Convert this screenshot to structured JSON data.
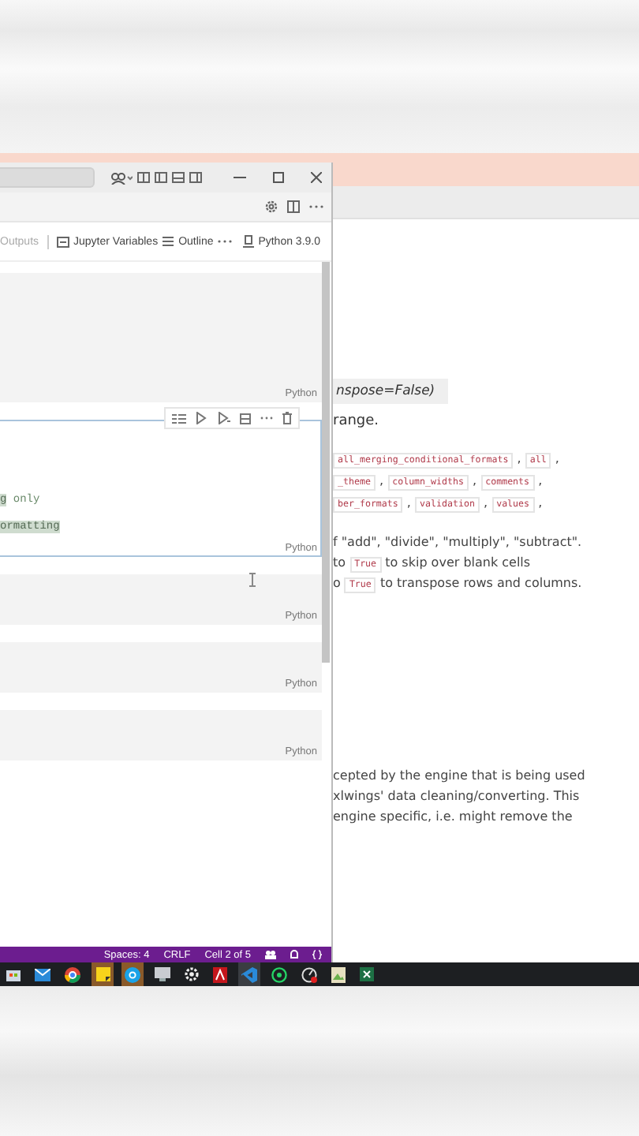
{
  "notebook_toolbar": [
    {
      "label": "Outputs",
      "disabled": true,
      "kind": "plain"
    },
    {
      "label": "Jupyter Variables",
      "disabled": false,
      "kind": "variables"
    },
    {
      "label": "Outline",
      "disabled": false,
      "kind": "outline"
    }
  ],
  "kernel": "Python 3.9.0",
  "cells": [
    {
      "language": "Python",
      "selected": false
    },
    {
      "language": "Python",
      "selected": true,
      "lines": [
        [
          {
            "text": "g",
            "highlighted": true
          },
          {
            "text": " only",
            "highlighted": false
          }
        ],
        [
          {
            "text": "ormatting",
            "highlighted": true
          }
        ]
      ]
    },
    {
      "language": "Python",
      "selected": false
    },
    {
      "language": "Python",
      "selected": false
    },
    {
      "language": "Python",
      "selected": false
    }
  ],
  "status_bar": [
    "Spaces: 4",
    "CRLF",
    "Cell 2 of 5"
  ],
  "docs": {
    "signature": "nspose=False)",
    "sentence": "range.",
    "code_lines": [
      [
        {
          "text": "all_merging_conditional_formats",
          "code": true
        },
        {
          "text": " , ",
          "code": false
        },
        {
          "text": "all",
          "code": true
        },
        {
          "text": " ,",
          "code": false
        }
      ],
      [
        {
          "text": "_theme",
          "code": true
        },
        {
          "text": " , ",
          "code": false
        },
        {
          "text": "column_widths",
          "code": true
        },
        {
          "text": " , ",
          "code": false
        },
        {
          "text": "comments",
          "code": true
        },
        {
          "text": " ,",
          "code": false
        }
      ],
      [
        {
          "text": "ber_formats",
          "code": true
        },
        {
          "text": " , ",
          "code": false
        },
        {
          "text": "validation",
          "code": true
        },
        {
          "text": " , ",
          "code": false
        },
        {
          "text": "values",
          "code": true
        },
        {
          "text": " ,",
          "code": false
        }
      ]
    ],
    "options": [
      [
        {
          "text": "f \"add\", \"divide\", \"multiply\", \"subtract\".",
          "code": false
        }
      ],
      [
        {
          "text": "to ",
          "code": false
        },
        {
          "text": "True",
          "code": true
        },
        {
          "text": " to skip over blank cells",
          "code": false
        }
      ],
      [
        {
          "text": "o ",
          "code": false
        },
        {
          "text": "True",
          "code": true
        },
        {
          "text": " to transpose rows and columns.",
          "code": false
        }
      ]
    ],
    "paragraph": [
      "cepted by the engine that is being used",
      "xlwings' data cleaning/converting. This",
      "engine specific, i.e. might remove the"
    ]
  }
}
